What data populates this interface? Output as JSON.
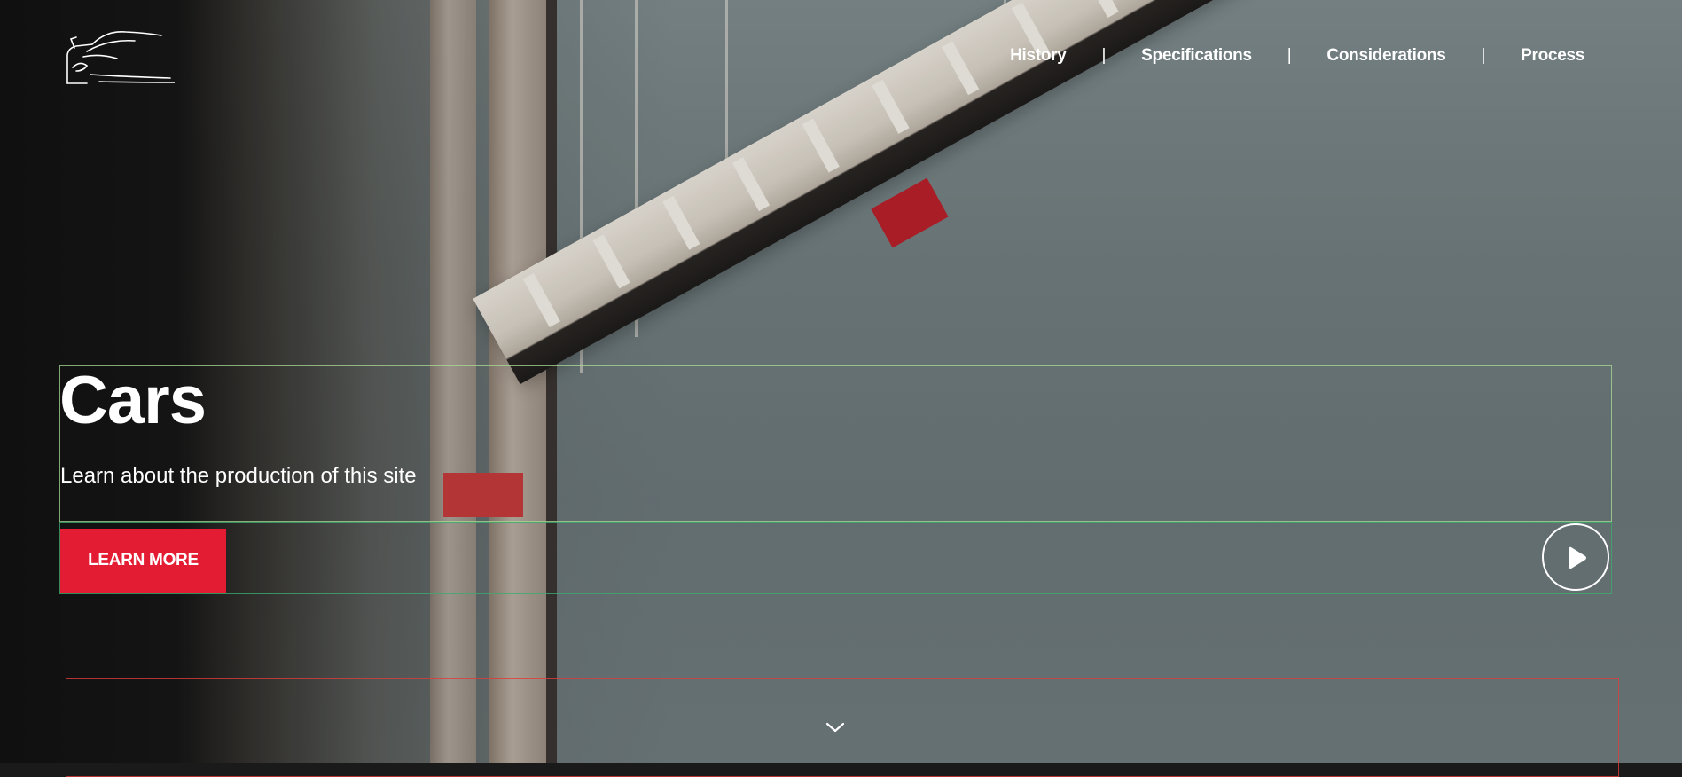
{
  "header": {
    "logo_icon": "car-outline-logo",
    "nav": [
      {
        "label": "History"
      },
      {
        "label": "Specifications"
      },
      {
        "label": "Considerations"
      },
      {
        "label": "Process"
      }
    ],
    "separator": "|"
  },
  "hero": {
    "title": "Cars",
    "subtitle": "Learn about the production of this site",
    "cta_label": "LEARN MORE",
    "cta_color": "#e31c34",
    "play_icon": "play-icon",
    "scroll_icon": "chevron-down-icon"
  }
}
